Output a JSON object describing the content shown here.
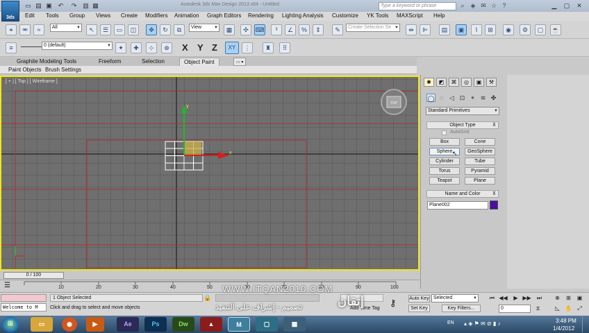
{
  "window": {
    "title": "Autodesk 3ds Max Design 2013 x64 - Untitled",
    "search_placeholder": "Type a keyword or phrase"
  },
  "menu": [
    "Edit",
    "Tools",
    "Group",
    "Views",
    "Create",
    "Modifiers",
    "Animation",
    "Graph Editors",
    "Rendering",
    "Lighting Analysis",
    "Customize",
    "YK Tools",
    "MAXScript",
    "Help"
  ],
  "toolbar1": {
    "selection_filter": "All",
    "reference_coord": "View",
    "selection_set_placeholder": "Create Selection Se"
  },
  "toolbar2": {
    "layer": "0 (default)",
    "axes": [
      "X",
      "Y",
      "Z",
      "XY"
    ]
  },
  "ribbon": {
    "tabs": [
      "Graphite Modeling Tools",
      "Freeform",
      "Selection",
      "Object Paint"
    ],
    "active_tab": "Object Paint",
    "subtabs": [
      "Paint Objects",
      "Brush Settings"
    ]
  },
  "viewport": {
    "label": "[ + ] [ Top ] [ Wireframe ]",
    "viewcube_label": "TOP",
    "axis_x": "x",
    "axis_y": "y"
  },
  "command_panel": {
    "category": "Standard Primitives",
    "object_type_title": "Object Type",
    "autogrid_label": "AutoGrid",
    "primitives": [
      "Box",
      "Cone",
      "Sphere",
      "GeoSphere",
      "Cylinder",
      "Tube",
      "Torus",
      "Pyramid",
      "Teapot",
      "Plane"
    ],
    "name_color_title": "Name and Color",
    "object_name": "Plane002",
    "object_color": "#4a0fa0"
  },
  "timeline": {
    "frame_display": "0 / 100",
    "ruler_ticks": [
      "10",
      "20",
      "30",
      "40",
      "50",
      "60",
      "70",
      "80",
      "90",
      "100"
    ]
  },
  "status": {
    "welcome": "Welcome to M",
    "selection": "1 Object Selected",
    "prompt": "Click and drag to select and move objects",
    "auto_key": "Auto Key",
    "set_key": "Set Key",
    "key_mode": "Selected",
    "key_filters": "Key Filters...",
    "frame_field": "0",
    "add_time_tag": "Add Time Tag"
  },
  "watermark": {
    "url": "WWW.ITQAN2010.COM",
    "arabic": "تصميم - إشراف على التنفيذ",
    "logo": "إتقان"
  },
  "taskbar": {
    "apps": [
      "Ae",
      "Ps",
      "Dw"
    ],
    "lang": "EN",
    "time": "3:48 PM",
    "date": "1/4/2012"
  }
}
